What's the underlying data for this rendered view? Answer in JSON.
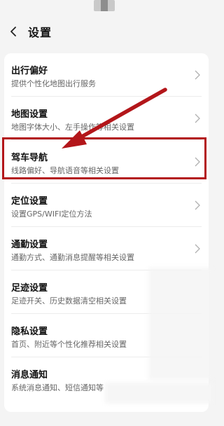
{
  "header": {
    "title": "设置"
  },
  "settings": [
    {
      "title": "出行偏好",
      "subtitle": "提供个性化地图出行服务"
    },
    {
      "title": "地图设置",
      "subtitle": "地图字体大小、左手操作等相关设置"
    },
    {
      "title": "驾车导航",
      "subtitle": "线路偏好、导航语音等相关设置"
    },
    {
      "title": "定位设置",
      "subtitle": "设置GPS/WIFI定位方法"
    },
    {
      "title": "通勤设置",
      "subtitle": "通勤方式、通勤消息提醒等相关设置"
    },
    {
      "title": "足迹设置",
      "subtitle": "足迹开关、历史数据清空相关设置"
    },
    {
      "title": "隐私设置",
      "subtitle": "首页、附近等个性化推荐相关设置"
    },
    {
      "title": "消息通知",
      "subtitle": "系统消息通知、短信通知等"
    }
  ],
  "annotation": {
    "highlight_color": "#b3161a",
    "highlighted_item": "驾车导航"
  }
}
